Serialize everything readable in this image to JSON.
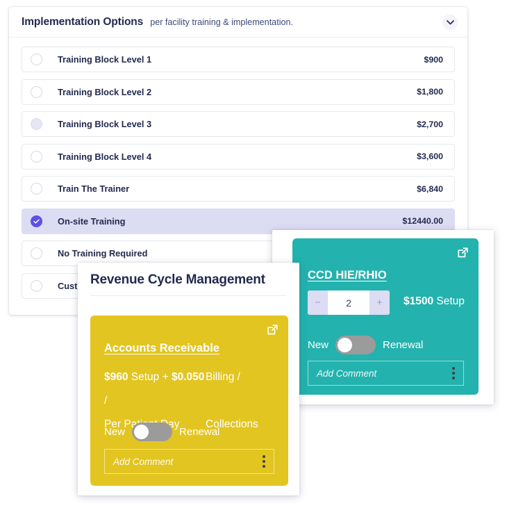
{
  "implementation": {
    "title": "Implementation Options",
    "subtitle": "per facility training & implementation.",
    "collapse_icon": "chevron-down-icon",
    "options": [
      {
        "label": "Training Block Level 1",
        "price": "$900",
        "state": "unselected"
      },
      {
        "label": "Training Block Level 2",
        "price": "$1,800",
        "state": "unselected"
      },
      {
        "label": "Training Block Level 3",
        "price": "$2,700",
        "state": "hover"
      },
      {
        "label": "Training Block Level 4",
        "price": "$3,600",
        "state": "unselected"
      },
      {
        "label": "Train The Trainer",
        "price": "$6,840",
        "state": "unselected"
      },
      {
        "label": "On-site Training",
        "price": "$12440.00",
        "state": "selected"
      },
      {
        "label": "No Training Required",
        "price": "",
        "state": "unselected"
      },
      {
        "label": "Custom Training",
        "price": "",
        "state": "unselected"
      }
    ]
  },
  "teal_panel": {
    "card": {
      "name": "CCD HIE/RHIO",
      "open_icon": "external-link-icon",
      "quantity": "2",
      "decrement_label": "−",
      "increment_label": "+",
      "setup_price": "$1500",
      "setup_label": "Setup",
      "toggle_left_label": "New",
      "toggle_right_label": "Renewal",
      "toggle_position": "left",
      "comment_placeholder": "Add Comment",
      "menu_icon": "kebab-menu-icon",
      "color": "#23b2ae"
    }
  },
  "rcm_panel": {
    "title": "Revenue Cycle Management",
    "card": {
      "name": "Accounts Receivable",
      "open_icon": "external-link-icon",
      "price_setup_amount": "$960",
      "price_setup_label": "Setup +",
      "price_rate_amount": "$0.050",
      "price_rate_sep": "/",
      "price_unit": "Per Patient Day",
      "price_category_line1": "Billing /",
      "price_category_line2": "Collections",
      "toggle_left_label": "New",
      "toggle_right_label": "Renewal",
      "toggle_position": "left",
      "comment_placeholder": "Add Comment",
      "menu_icon": "kebab-menu-icon",
      "color": "#e2c520"
    }
  },
  "theme": {
    "accent_purple": "#5d50e6",
    "selected_row_bg": "#dcdcf3",
    "text_dark": "#222a4f"
  }
}
